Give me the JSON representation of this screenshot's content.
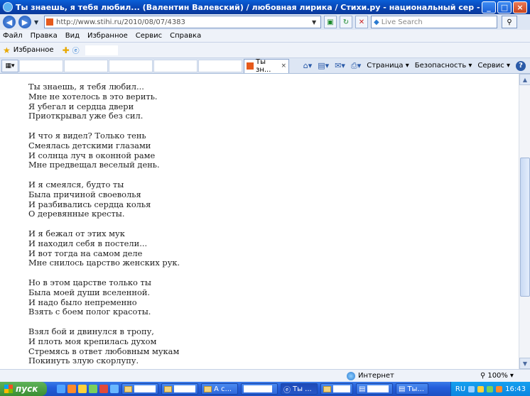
{
  "window": {
    "title": "Ты знаешь, я тебя любил... (Валентин Валевский) / любовная лирика / Стихи.ру - национальный сер - Windows Internet Explorer",
    "minimize": "_",
    "maximize": "□",
    "close": "×"
  },
  "address": {
    "back": "◀",
    "forward": "▶",
    "url": "http://www.stihi.ru/2010/08/07/4383",
    "search_placeholder": "Live Search"
  },
  "menu": [
    "Файл",
    "Правка",
    "Вид",
    "Избранное",
    "Сервис",
    "Справка"
  ],
  "favorites": {
    "label": "Избранное"
  },
  "tabs": {
    "active_label": "Ты зн...",
    "close": "×"
  },
  "commands": {
    "page": "Страница ▾",
    "security": "Безопасность ▾",
    "tools": "Сервис ▾"
  },
  "poem": {
    "stanzas": [
      [
        "Ты знаешь, я тебя любил...",
        "Мне не хотелось в это верить.",
        "Я убегал и сердца двери",
        "Приоткрывал уже без сил."
      ],
      [
        "И что я видел? Только тень",
        "Смеялась детскими глазами",
        "И солнца луч в оконной раме",
        "Мне предвещал веселый день."
      ],
      [
        "И я смеялся, будто ты",
        "Была причиной своеволья",
        "И разбивались сердца колья",
        "О деревянные кресты."
      ],
      [
        "И я бежал от этих мук",
        "И находил себя в постели...",
        "И вот тогда на самом деле",
        "Мне снилось царство женских рук."
      ],
      [
        "Но в этом царстве только ты",
        "Была моей души вселенной.",
        "И надо было непременно",
        "Взять с боем полог красоты."
      ],
      [
        "Взял бой и двинулся в тропу,",
        "И плоть моя крепилась духом",
        "Стремясь в ответ любовным мукам",
        "Покинуть злую скорлупу."
      ]
    ]
  },
  "status": {
    "zone": "Интернет",
    "zoom": "100%"
  },
  "taskbar": {
    "start": "пуск",
    "task_a": "А с...",
    "task_ie": "Ты ...",
    "task_last": "Ты...",
    "lang": "RU",
    "clock": "16:43"
  }
}
